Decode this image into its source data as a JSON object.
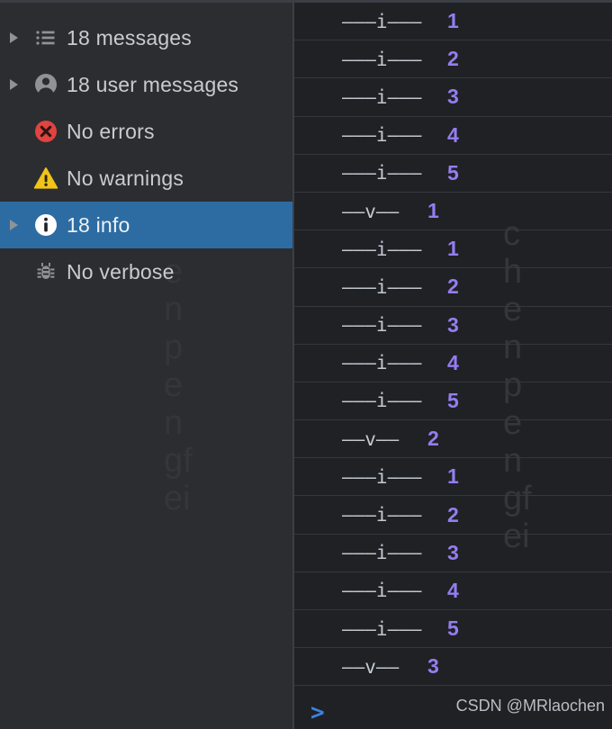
{
  "sidebar": {
    "items": [
      {
        "label": "18 messages",
        "icon": "list-icon",
        "expandable": true,
        "selected": false
      },
      {
        "label": "18 user messages",
        "icon": "person-icon",
        "expandable": true,
        "selected": false
      },
      {
        "label": "No errors",
        "icon": "error-icon",
        "expandable": false,
        "selected": false
      },
      {
        "label": "No warnings",
        "icon": "warning-icon",
        "expandable": false,
        "selected": false
      },
      {
        "label": "18 info",
        "icon": "info-icon",
        "expandable": true,
        "selected": true
      },
      {
        "label": "No verbose",
        "icon": "bug-icon",
        "expandable": false,
        "selected": false
      }
    ]
  },
  "log": {
    "rows": [
      {
        "dashes": "———i———",
        "num": "1",
        "level": "i"
      },
      {
        "dashes": "———i———",
        "num": "2",
        "level": "i"
      },
      {
        "dashes": "———i———",
        "num": "3",
        "level": "i"
      },
      {
        "dashes": "———i———",
        "num": "4",
        "level": "i"
      },
      {
        "dashes": "———i———",
        "num": "5",
        "level": "i"
      },
      {
        "dashes": "——v——",
        "num": "1",
        "level": "v"
      },
      {
        "dashes": "———i———",
        "num": "1",
        "level": "i"
      },
      {
        "dashes": "———i———",
        "num": "2",
        "level": "i"
      },
      {
        "dashes": "———i———",
        "num": "3",
        "level": "i"
      },
      {
        "dashes": "———i———",
        "num": "4",
        "level": "i"
      },
      {
        "dashes": "———i———",
        "num": "5",
        "level": "i"
      },
      {
        "dashes": "——v——",
        "num": "2",
        "level": "v"
      },
      {
        "dashes": "———i———",
        "num": "1",
        "level": "i"
      },
      {
        "dashes": "———i———",
        "num": "2",
        "level": "i"
      },
      {
        "dashes": "———i———",
        "num": "3",
        "level": "i"
      },
      {
        "dashes": "———i———",
        "num": "4",
        "level": "i"
      },
      {
        "dashes": "———i———",
        "num": "5",
        "level": "i"
      },
      {
        "dashes": "——v——",
        "num": "3",
        "level": "v"
      }
    ],
    "prompt_chevron": ">"
  },
  "watermarks": {
    "vertical_sidebar": [
      "e",
      "n",
      "p",
      "e",
      "n",
      "gf",
      "ei"
    ],
    "vertical_log": [
      "c",
      "h",
      "e",
      "n",
      "p",
      "e",
      "n",
      "gf",
      "ei"
    ],
    "csdn": "CSDN @MRlaochen"
  },
  "colors": {
    "selection_blue": "#2d6ca3",
    "number_purple": "#957df0",
    "error_red": "#e0443e",
    "warning_yellow": "#f0c419",
    "info_white": "#ffffff",
    "prompt_blue": "#3b82dd",
    "sidebar_bg": "#2b2d31",
    "log_bg": "#1f2125"
  }
}
